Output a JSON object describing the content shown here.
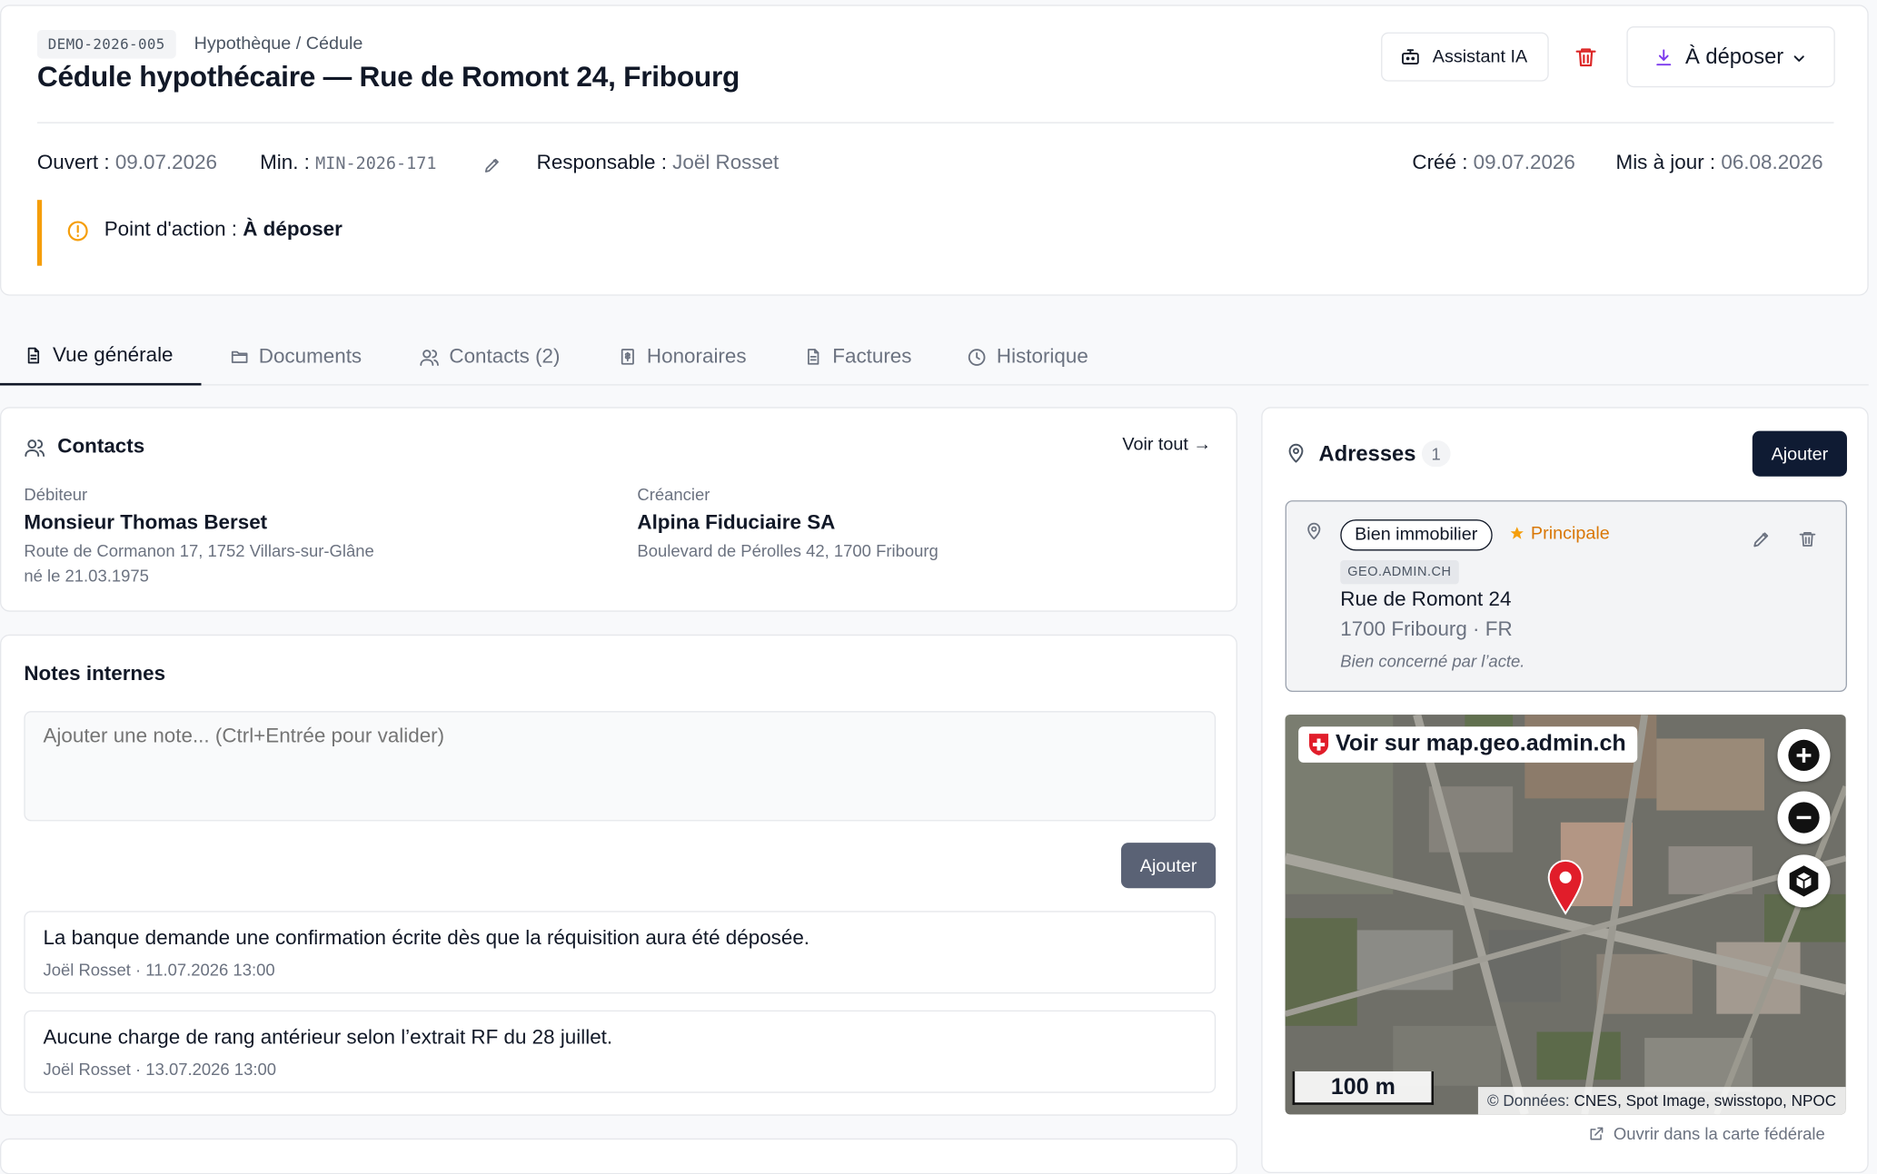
{
  "case": {
    "reference": "DEMO-2026-005",
    "category": "Hypothèque / Cédule",
    "title": "Cédule hypothécaire — Rue de Romont 24, Fribourg"
  },
  "toolbar": {
    "assistant_label": "Assistant IA",
    "status_label": "À déposer"
  },
  "meta": {
    "opened_label": "Ouvert :",
    "opened_value": "09.07.2026",
    "minute_label": "Min. :",
    "minute_value": "MIN-2026-171",
    "responsible_label": "Responsable :",
    "responsible_value": "Joël Rosset",
    "created_label": "Créé :",
    "created_value": "09.07.2026",
    "updated_label": "Mis à jour :",
    "updated_value": "06.08.2026"
  },
  "action_point": {
    "label": "Point d'action :",
    "value": "À déposer"
  },
  "tabs": [
    {
      "label": "Vue générale",
      "icon": "document-icon",
      "active": true
    },
    {
      "label": "Documents",
      "icon": "folder-icon"
    },
    {
      "label": "Contacts (2)",
      "icon": "users-icon"
    },
    {
      "label": "Honoraires",
      "icon": "receipt-icon"
    },
    {
      "label": "Factures",
      "icon": "invoice-icon"
    },
    {
      "label": "Historique",
      "icon": "clock-icon"
    }
  ],
  "contacts": {
    "title": "Contacts",
    "see_all": "Voir tout →",
    "items": [
      {
        "role": "Débiteur",
        "name": "Monsieur Thomas Berset",
        "address": "Route de Cormanon 17, 1752 Villars-sur-Glâne",
        "extra": "né le 21.03.1975"
      },
      {
        "role": "Créancier",
        "name": "Alpina Fiduciaire SA",
        "address": "Boulevard de Pérolles 42, 1700 Fribourg"
      }
    ]
  },
  "notes": {
    "title": "Notes internes",
    "placeholder": "Ajouter une note... (Ctrl+Entrée pour valider)",
    "add_label": "Ajouter",
    "items": [
      {
        "text": "La banque demande une confirmation écrite dès que la réquisition aura été déposée.",
        "meta": "Joël Rosset · 11.07.2026 13:00"
      },
      {
        "text": "Aucune charge de rang antérieur selon l’extrait RF du 28 juillet.",
        "meta": "Joël Rosset · 13.07.2026 13:00"
      }
    ]
  },
  "addresses": {
    "title": "Adresses",
    "count": "1",
    "add_label": "Ajouter",
    "item": {
      "type": "Bien immobilier",
      "principal": "Principale",
      "source": "GEO.ADMIN.CH",
      "street": "Rue de Romont 24",
      "city": "1700 Fribourg · FR",
      "description": "Bien concerné par l’acte."
    },
    "map": {
      "link_label": "Voir sur map.geo.admin.ch",
      "scale": "100 m",
      "attribution_label": "© Données:",
      "attribution_value": "CNES, Spot Image, swisstopo, NPOC"
    },
    "open_federal": "Ouvrir dans la carte fédérale"
  },
  "colors": {
    "accent_warning": "#f59e0b",
    "danger": "#dc2626",
    "primary_dark": "#0f1b33",
    "download_purple": "#7c3aed",
    "map_pin": "#e11d2a"
  }
}
